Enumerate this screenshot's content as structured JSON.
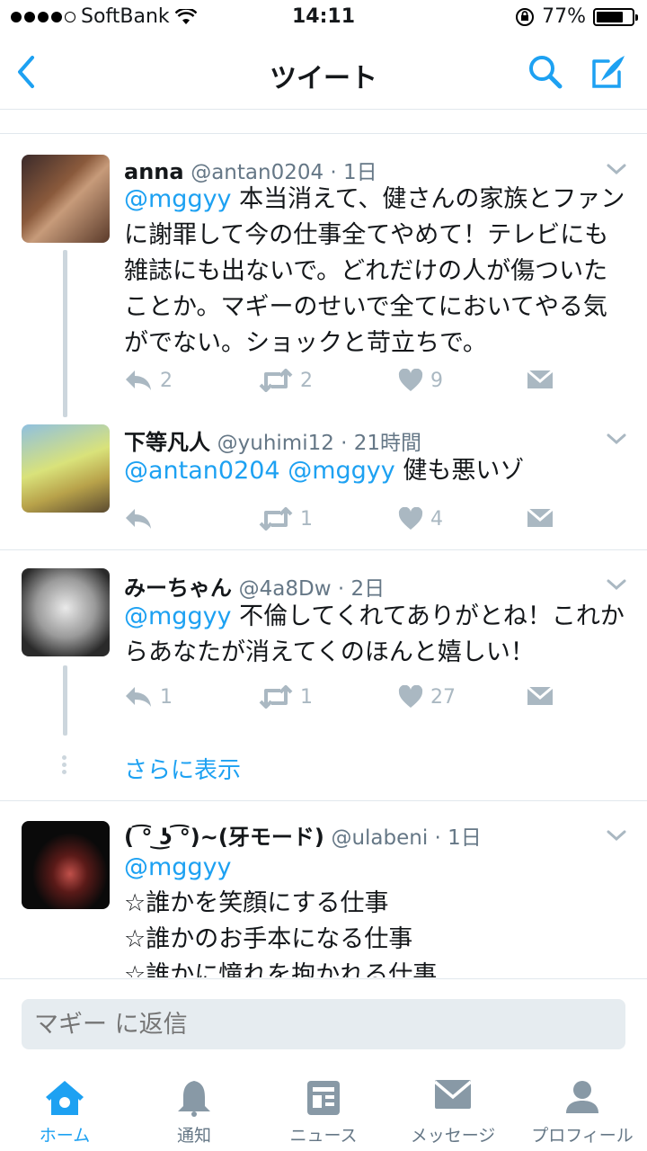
{
  "status_bar": {
    "carrier": "SoftBank",
    "time": "14:11",
    "battery": "77%",
    "battery_level": 0.77
  },
  "nav": {
    "title": "ツイート",
    "back_icon": "chevron-left-icon",
    "search_icon": "search-icon",
    "compose_icon": "compose-icon"
  },
  "tweets": [
    {
      "name": "anna",
      "handle": "@antan0204 · 1日",
      "mention": "@mggyy",
      "text": " 本当消えて、健さんの家族とファンに謝罪して今の仕事全てやめて！テレビにも雑誌にも出ないで。どれだけの人が傷ついたことか。マギーのせいで全てにおいてやる気がでない。ショックと苛立ちで。",
      "replies": "2",
      "retweets": "2",
      "likes": "9"
    },
    {
      "name": "下等凡人",
      "handle": "@yuhimi12 · 21時間",
      "mention": "@antan0204 @mggyy",
      "text": " 健も悪いゾ",
      "replies": "",
      "retweets": "1",
      "likes": "4"
    },
    {
      "name": "みーちゃん",
      "handle": "@4a8Dw · 2日",
      "mention": "@mggyy",
      "text": " 不倫してくれてありがとね！これからあなたが消えてくのほんと嬉しい！",
      "replies": "1",
      "retweets": "1",
      "likes": "27"
    },
    {
      "name": "( ͡° ͜ʖ ͡°)~(牙モード)",
      "handle": "@ulabeni · 1日",
      "mention": "@mggyy",
      "text": "☆誰かを笑顔にする仕事\n☆誰かのお手本になる仕事\n☆誰かに憧れを抱かれる仕事"
    }
  ],
  "show_more": "さらに表示",
  "reply": {
    "placeholder": "マギー に返信"
  },
  "tabs": [
    {
      "label": "ホーム",
      "icon": "home-icon",
      "active": true
    },
    {
      "label": "通知",
      "icon": "bell-icon",
      "active": false
    },
    {
      "label": "ニュース",
      "icon": "news-icon",
      "active": false
    },
    {
      "label": "メッセージ",
      "icon": "envelope-icon",
      "active": false
    },
    {
      "label": "プロフィール",
      "icon": "profile-icon",
      "active": false
    }
  ],
  "colors": {
    "accent": "#1da1f2",
    "muted": "#aab8c2",
    "text": "#14171a"
  }
}
